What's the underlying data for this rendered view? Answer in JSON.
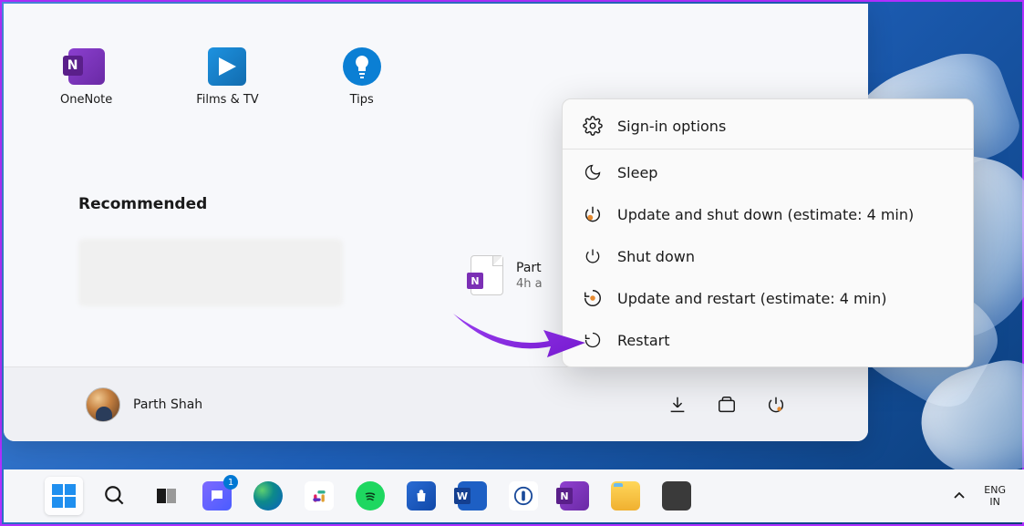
{
  "apps": {
    "onenote": "OneNote",
    "films": "Films & TV",
    "tips": "Tips"
  },
  "recommended": {
    "heading": "Recommended",
    "item": {
      "title": "Part",
      "subtitle": "4h a"
    }
  },
  "user": {
    "name": "Parth Shah"
  },
  "power_menu": {
    "signin": "Sign-in options",
    "sleep": "Sleep",
    "update_shutdown": "Update and shut down (estimate: 4 min)",
    "shutdown": "Shut down",
    "update_restart": "Update and restart (estimate: 4 min)",
    "restart": "Restart"
  },
  "taskbar": {
    "chat_badge": "1",
    "lang_top": "ENG",
    "lang_bottom": "IN"
  }
}
